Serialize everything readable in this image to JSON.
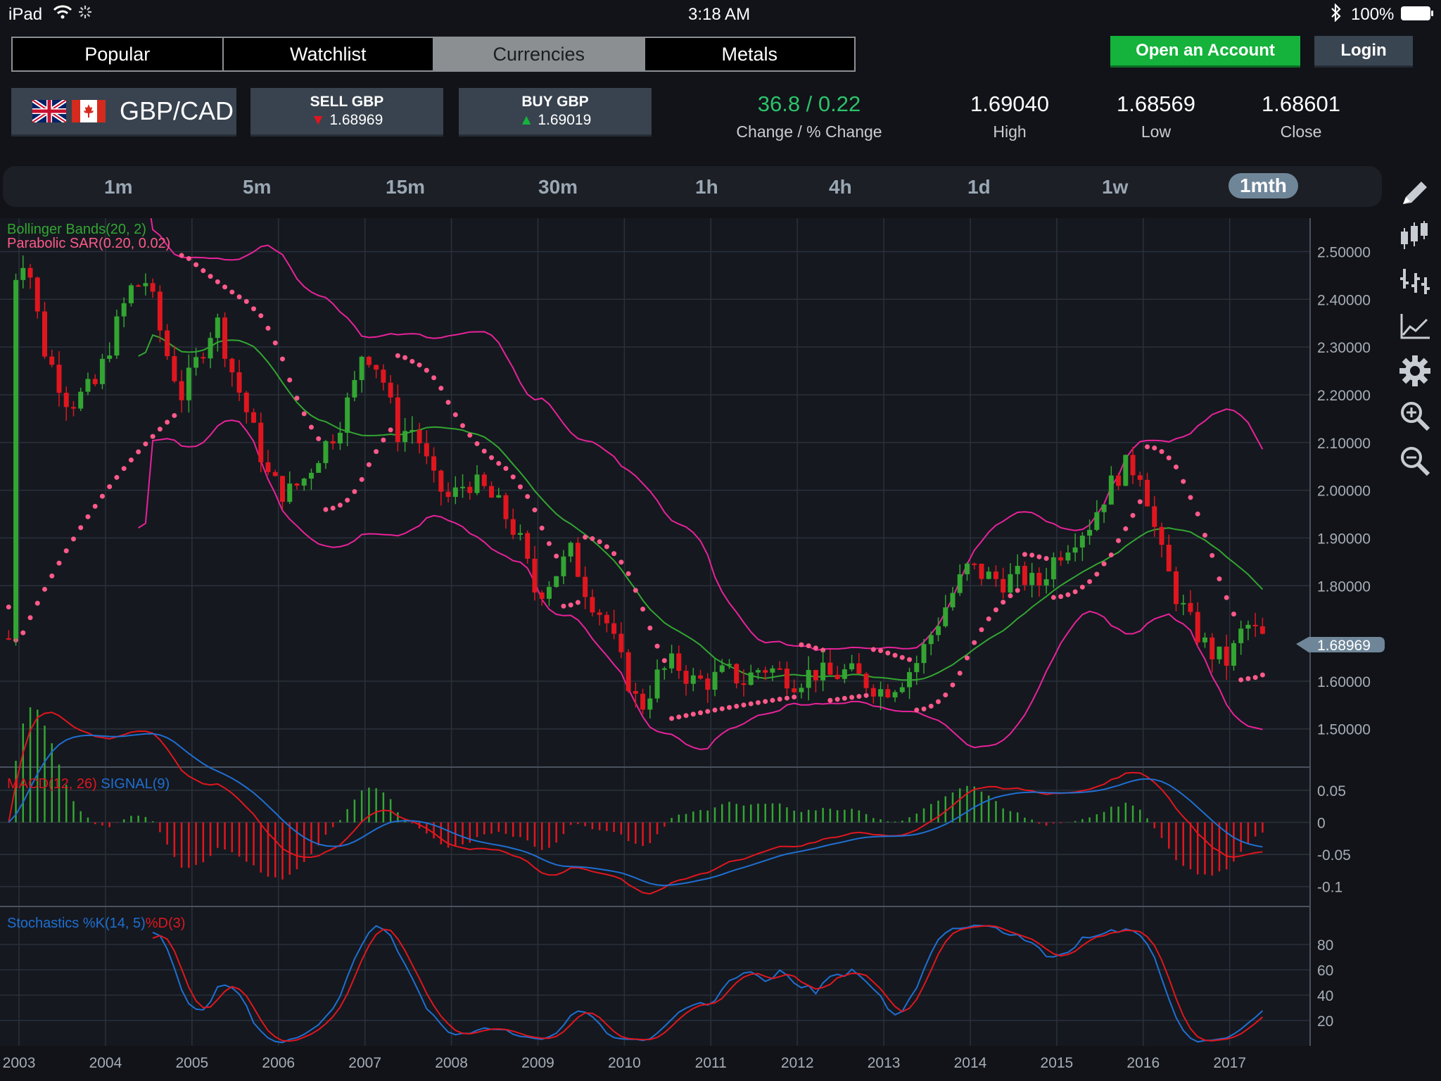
{
  "status_bar": {
    "device": "iPad",
    "time": "3:18 AM",
    "battery": "100%"
  },
  "nav": {
    "tabs": [
      "Popular",
      "Watchlist",
      "Currencies",
      "Metals"
    ],
    "active": "Currencies"
  },
  "account": {
    "open_label": "Open an Account",
    "login_label": "Login"
  },
  "instrument": {
    "pair": "GBP/CAD",
    "sell_label": "SELL GBP",
    "sell_price": "1.68969",
    "buy_label": "BUY GBP",
    "buy_price": "1.69019",
    "change": "36.8 / 0.22",
    "change_label": "Change / % Change",
    "high": "1.69040",
    "high_label": "High",
    "low": "1.68569",
    "low_label": "Low",
    "close": "1.68601",
    "close_label": "Close"
  },
  "timeframes": [
    "1m",
    "5m",
    "15m",
    "30m",
    "1h",
    "4h",
    "1d",
    "1w",
    "1mth"
  ],
  "active_timeframe": "1mth",
  "tools": [
    "pencil-icon",
    "candlestick-icon",
    "bar-chart-icon",
    "line-chart-icon",
    "gear-icon",
    "zoom-in-icon",
    "zoom-out-icon"
  ],
  "colors": {
    "up": "#33a532",
    "down": "#e0161f",
    "bb": "#e8229a",
    "sar": "#ff5a8a",
    "macd": "#e0161f",
    "signal": "#1f6fd1",
    "stoch_k": "#1f6fd1",
    "stoch_d": "#e0161f",
    "green": "#15b33c"
  },
  "chart_data": {
    "type": "candlestick",
    "indicator_labels": {
      "bb": "Bollinger Bands(20, 2)",
      "sar": "Parabolic SAR(0.20, 0.02)",
      "macd": "MACD(12, 26)",
      "signal": "SIGNAL(9)",
      "stoch_k": "Stochastics %K(14, 5)",
      "stoch_d": "%D(3)"
    },
    "x_labels": [
      "2003",
      "2004",
      "2005",
      "2006",
      "2007",
      "2008",
      "2009",
      "2010",
      "2011",
      "2012",
      "2013",
      "2014",
      "2015",
      "2016",
      "2017"
    ],
    "price_axis": {
      "ticks": [
        "2.50000",
        "2.40000",
        "2.30000",
        "2.20000",
        "2.10000",
        "2.00000",
        "1.90000",
        "1.80000",
        "1.60000",
        "1.50000"
      ],
      "ylim": [
        1.42,
        2.57
      ]
    },
    "current_price": "1.68969",
    "macd_axis": {
      "ticks": [
        "0.05",
        "0",
        "-0.05",
        "-0.1"
      ],
      "ylim": [
        -0.12,
        0.075
      ]
    },
    "stoch_axis": {
      "ticks": [
        "80",
        "60",
        "40",
        "20"
      ],
      "ylim": [
        0,
        100
      ]
    },
    "close_path": [
      [
        2002.9,
        2.42
      ],
      [
        2003.1,
        2.5
      ],
      [
        2003.3,
        2.3
      ],
      [
        2003.6,
        2.18
      ],
      [
        2003.9,
        2.22
      ],
      [
        2004.1,
        2.32
      ],
      [
        2004.3,
        2.42
      ],
      [
        2004.5,
        2.44
      ],
      [
        2004.7,
        2.3
      ],
      [
        2004.9,
        2.2
      ],
      [
        2005.1,
        2.28
      ],
      [
        2005.3,
        2.36
      ],
      [
        2005.5,
        2.24
      ],
      [
        2005.7,
        2.14
      ],
      [
        2005.9,
        2.03
      ],
      [
        2006.1,
        1.99
      ],
      [
        2006.3,
        2.02
      ],
      [
        2006.5,
        2.08
      ],
      [
        2006.7,
        2.13
      ],
      [
        2006.9,
        2.22
      ],
      [
        2007.0,
        2.3
      ],
      [
        2007.2,
        2.25
      ],
      [
        2007.4,
        2.12
      ],
      [
        2007.6,
        2.13
      ],
      [
        2007.8,
        2.02
      ],
      [
        2008.0,
        1.98
      ],
      [
        2008.2,
        2.02
      ],
      [
        2008.4,
        2.0
      ],
      [
        2008.6,
        1.96
      ],
      [
        2008.8,
        1.9
      ],
      [
        2009.0,
        1.78
      ],
      [
        2009.2,
        1.82
      ],
      [
        2009.4,
        1.87
      ],
      [
        2009.6,
        1.78
      ],
      [
        2009.8,
        1.73
      ],
      [
        2010.0,
        1.63
      ],
      [
        2010.2,
        1.54
      ],
      [
        2010.4,
        1.61
      ],
      [
        2010.6,
        1.64
      ],
      [
        2010.8,
        1.6
      ],
      [
        2011.0,
        1.6
      ],
      [
        2011.2,
        1.62
      ],
      [
        2011.4,
        1.6
      ],
      [
        2011.6,
        1.63
      ],
      [
        2011.8,
        1.62
      ],
      [
        2012.0,
        1.6
      ],
      [
        2012.2,
        1.62
      ],
      [
        2012.4,
        1.61
      ],
      [
        2012.6,
        1.62
      ],
      [
        2012.8,
        1.6
      ],
      [
        2013.0,
        1.58
      ],
      [
        2013.2,
        1.6
      ],
      [
        2013.4,
        1.64
      ],
      [
        2013.6,
        1.71
      ],
      [
        2013.8,
        1.78
      ],
      [
        2014.0,
        1.84
      ],
      [
        2014.2,
        1.82
      ],
      [
        2014.4,
        1.81
      ],
      [
        2014.6,
        1.82
      ],
      [
        2014.8,
        1.8
      ],
      [
        2015.0,
        1.86
      ],
      [
        2015.2,
        1.9
      ],
      [
        2015.4,
        1.93
      ],
      [
        2015.6,
        2.0
      ],
      [
        2015.8,
        2.05
      ],
      [
        2016.0,
        2.04
      ],
      [
        2016.2,
        1.88
      ],
      [
        2016.4,
        1.78
      ],
      [
        2016.6,
        1.71
      ],
      [
        2016.8,
        1.66
      ],
      [
        2017.0,
        1.64
      ],
      [
        2017.2,
        1.72
      ],
      [
        2017.4,
        1.69
      ]
    ]
  }
}
